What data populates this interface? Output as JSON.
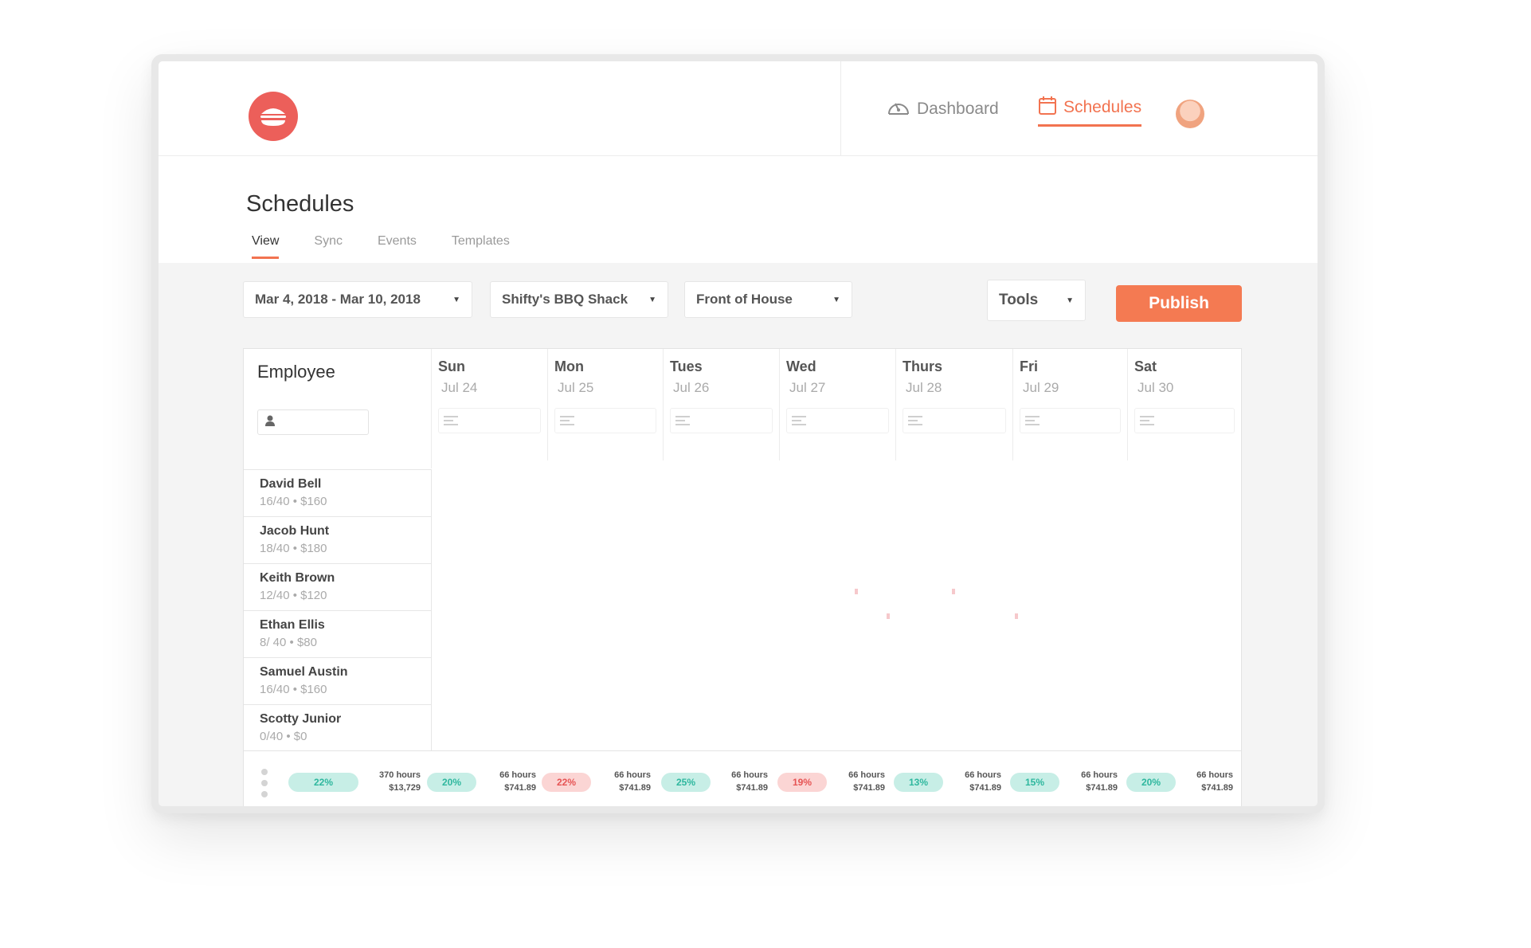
{
  "window": {
    "controls": [
      "close",
      "minimize",
      "maximize"
    ]
  },
  "nav": {
    "logo_icon": "burger-icon",
    "items": [
      {
        "label": "Dashboard",
        "icon": "speedometer-icon",
        "active": false
      },
      {
        "label": "Schedules",
        "icon": "calendar-icon",
        "active": true
      }
    ]
  },
  "header": {
    "title": "Schedules",
    "tabs": [
      "View",
      "Sync",
      "Events",
      "Templates"
    ],
    "active_tab": "View"
  },
  "toolbar": {
    "date_range": "Mar 4, 2018 - Mar 10, 2018",
    "location": "Shifty's BBQ Shack",
    "department": "Front of House",
    "tools_label": "Tools",
    "publish_label": "Publish"
  },
  "grid": {
    "employee_header": "Employee",
    "days": [
      {
        "name": "Sun",
        "date": "Jul 24"
      },
      {
        "name": "Mon",
        "date": "Jul 25"
      },
      {
        "name": "Tues",
        "date": "Jul 26"
      },
      {
        "name": "Wed",
        "date": "Jul 27"
      },
      {
        "name": "Thurs",
        "date": "Jul 28"
      },
      {
        "name": "Fri",
        "date": "Jul 29"
      },
      {
        "name": "Sat",
        "date": "Jul 30"
      }
    ],
    "employees": [
      {
        "name": "David Bell",
        "summary": "16/40 • $160"
      },
      {
        "name": "Jacob Hunt",
        "summary": "18/40 • $180"
      },
      {
        "name": "Keith Brown",
        "summary": "12/40 • $120"
      },
      {
        "name": "Ethan Ellis",
        "summary": "8/ 40 • $80"
      },
      {
        "name": "Samuel Austin",
        "summary": "16/40 • $160"
      },
      {
        "name": "Scotty Junior",
        "summary": "0/40 • $0"
      }
    ]
  },
  "footer": {
    "total": {
      "pill": "22%",
      "hours": "370 hours",
      "cost": "$13,729",
      "status": "good"
    },
    "days": [
      {
        "pill": "20%",
        "hours": "66 hours",
        "cost": "$741.89",
        "status": "good"
      },
      {
        "pill": "22%",
        "hours": "66 hours",
        "cost": "$741.89",
        "status": "bad"
      },
      {
        "pill": "25%",
        "hours": "66 hours",
        "cost": "$741.89",
        "status": "good"
      },
      {
        "pill": "19%",
        "hours": "66 hours",
        "cost": "$741.89",
        "status": "bad"
      },
      {
        "pill": "13%",
        "hours": "66 hours",
        "cost": "$741.89",
        "status": "good"
      },
      {
        "pill": "15%",
        "hours": "66 hours",
        "cost": "$741.89",
        "status": "good"
      },
      {
        "pill": "20%",
        "hours": "66 hours",
        "cost": "$741.89",
        "status": "good"
      }
    ]
  },
  "colors": {
    "accent": "#f47a52",
    "good": "#2eb79e",
    "bad": "#e65454"
  }
}
